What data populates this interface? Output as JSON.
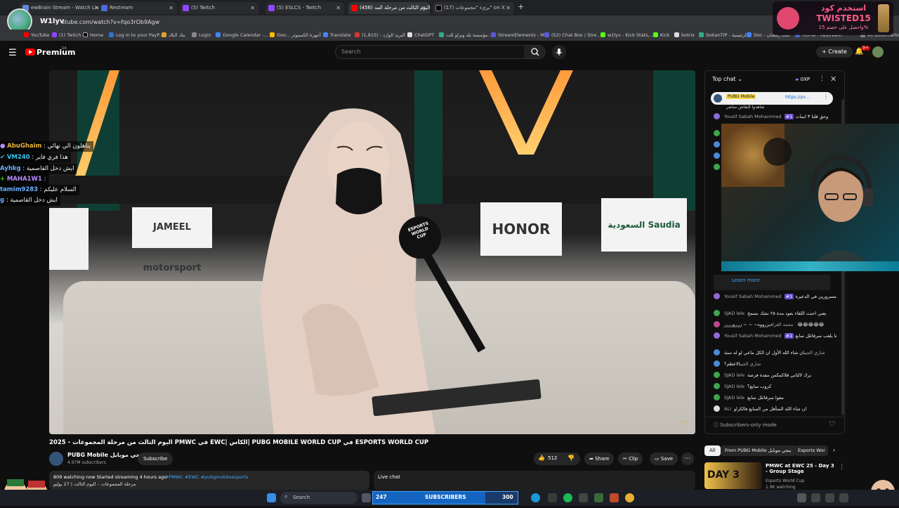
{
  "browser": {
    "tabs": [
      {
        "label": "ewBrain Stream - Watch Live o",
        "color": "#5f8ad8"
      },
      {
        "label": "Restream",
        "color": "#4b6bd6"
      },
      {
        "label": "(5) Twitch",
        "color": "#9146ff"
      },
      {
        "label": "(5) ESLCS - Twitch",
        "color": "#9146ff"
      },
      {
        "label": "اليوم الثالث من مرحلة المد (456)",
        "color": "#ff0000"
      },
      {
        "label": "(17) بريء \"مجموعات\" on X",
        "color": "#ffffff"
      }
    ],
    "window_title": "W1lyv",
    "url": "stube.com/watch?v=fqo3rOb9Agw",
    "bookmarks": [
      "YouTube",
      "(1) Twitch",
      "Home",
      "Log in to your PayP...",
      "بنك البلاد",
      "Login",
      "Google Calendar -...",
      "Goo... أجهزة الكمبيوتر",
      "Translate",
      "البريد الوارد - (1,815)",
      "ChatGPT",
      "مؤسسة بلد ويزلو للت...",
      "StreamElements - M...",
      "(52) Chat Box / Stre...",
      "w1lyv - Kick Stats,...",
      "Kick",
      "botrix",
      "DokanTIP - الرئيسية",
      "Doc - كتب رمضان",
      "Home - Restream",
      "All Bookmarks"
    ]
  },
  "promo": {
    "line1": "استخدم كود",
    "line2": "TWISTED15",
    "line3": "واحصل على خصم 15%"
  },
  "youtube": {
    "brand": "Premium",
    "region": "SA",
    "search_placeholder": "Search",
    "create_label": "Create",
    "notif_count": "9+"
  },
  "video": {
    "sponsors": [
      "JAMEEL motorsport",
      "HONOR",
      "السعودية Saudia",
      "ESPORTS WORLD CUP"
    ],
    "watermark": "ewc"
  },
  "overlay_chat": [
    {
      "name": "AbuGhaim",
      "text": "يتاهلون الي نهائي",
      "color": "#e8b53b"
    },
    {
      "name": "VM240",
      "text": "هذا فري فاير",
      "color": "#36c5ea"
    },
    {
      "name": "Ayhkg",
      "text": "ايش دخل القاصمية",
      "color": "#6ab0ff"
    },
    {
      "name": "MAHA1W1",
      "text": "",
      "color": "#b68cff"
    },
    {
      "name": "tamim9283",
      "text": "السلام عليكم",
      "color": "#6ab0ff"
    },
    {
      "name": "g",
      "text": "ايش دخل القاصمية",
      "color": "#6ab0ff"
    }
  ],
  "chat": {
    "header": "Top chat",
    "points": "0XP",
    "pinned_name": "PUBG Mobile",
    "pinned_link": "https://yo...",
    "pinned_text": "شاهدوا النقاش مباشر",
    "learn_more": "Learn more",
    "subscribers_only": "Subscribers-only mode",
    "messages": [
      {
        "name": "Yousif Sabah Mohammed",
        "text": "وحق قلنا ٣ ايمات",
        "color": "#8e6bd6",
        "badge": "#1"
      },
      {
        "name": "Yousif Sabah Mohammed",
        "text": "مسرين مسرورين في الدعيرة",
        "color": "#8e6bd6",
        "badge": "#1"
      },
      {
        "name": "SJAD lele",
        "text": "يعني احنت اللقاء بعود مدة ٢٥ نشك بسمح",
        "color": "#3fa34d"
      },
      {
        "name": "محمد العراقي",
        "text": "زرووه~ ~ ~ زررورررر 😂😂😂😂😂",
        "color": "#c04a8c"
      },
      {
        "name": "Yousif Sabah Mohammed",
        "text": "مرحبا جميعا يلعب سرقاتلل سابع",
        "color": "#8e6bd6",
        "badge": "#1"
      },
      {
        "name": "شاري الجيب",
        "text": "ان شاء الله الأول ان الكل ماعي لو له سنة",
        "color": "#4a8ad6"
      },
      {
        "name": "شاري الجيب",
        "text": "الاعظم؟",
        "color": "#4a8ad6"
      },
      {
        "name": "SJAD lele",
        "text": "يرك لالثاني قلاكمكس مقدة فرصة",
        "color": "#3fa34d"
      },
      {
        "name": "SJAD lele",
        "text": "كروب سابع؟",
        "color": "#3fa34d"
      },
      {
        "name": "SJAD lele",
        "text": "مقوا سرقاتلل سابع",
        "color": "#3fa34d"
      },
      {
        "name": "ALI",
        "text": "ان شاء الله المتأهل من السابع فالكراو",
        "color": "#ffffff"
      }
    ]
  },
  "below": {
    "title": "اليوم الثالث من مرحلة المجموعات - 2025 PMWC في EWC| الكأس| PUBG MOBILE WORLD CUP في ESPORTS WORLD CUP",
    "channel": "PUBG Mobile ببجي موبايل",
    "subs": "4.97M subscribers",
    "subscribe": "Subscribe",
    "likes": "512",
    "share": "Share",
    "clip": "Clip",
    "save": "Save",
    "watching": "809 watching now  Started streaming 4 hours ago",
    "tags": "#PMWC #EWC #pubgmobileesports",
    "desc2": "مرحلة المجموعات – اليوم الثالث | 27 يوليو",
    "live_chat": "Live chat",
    "chips": [
      "All",
      "From PUBG Mobile ببجي موبايل",
      "Esports Wor"
    ],
    "rec_title": "PMWC at EWC 25 - Day 3 - Group Stage",
    "rec_channel": "Esports World Cup",
    "rec_meta": "1.9K watching",
    "rec_thumb": "DAY 3"
  },
  "taskbar": {
    "search": "Search",
    "subs_count": "247",
    "subs_label": "SUBSCRIBERS",
    "subs_goal": "300"
  }
}
